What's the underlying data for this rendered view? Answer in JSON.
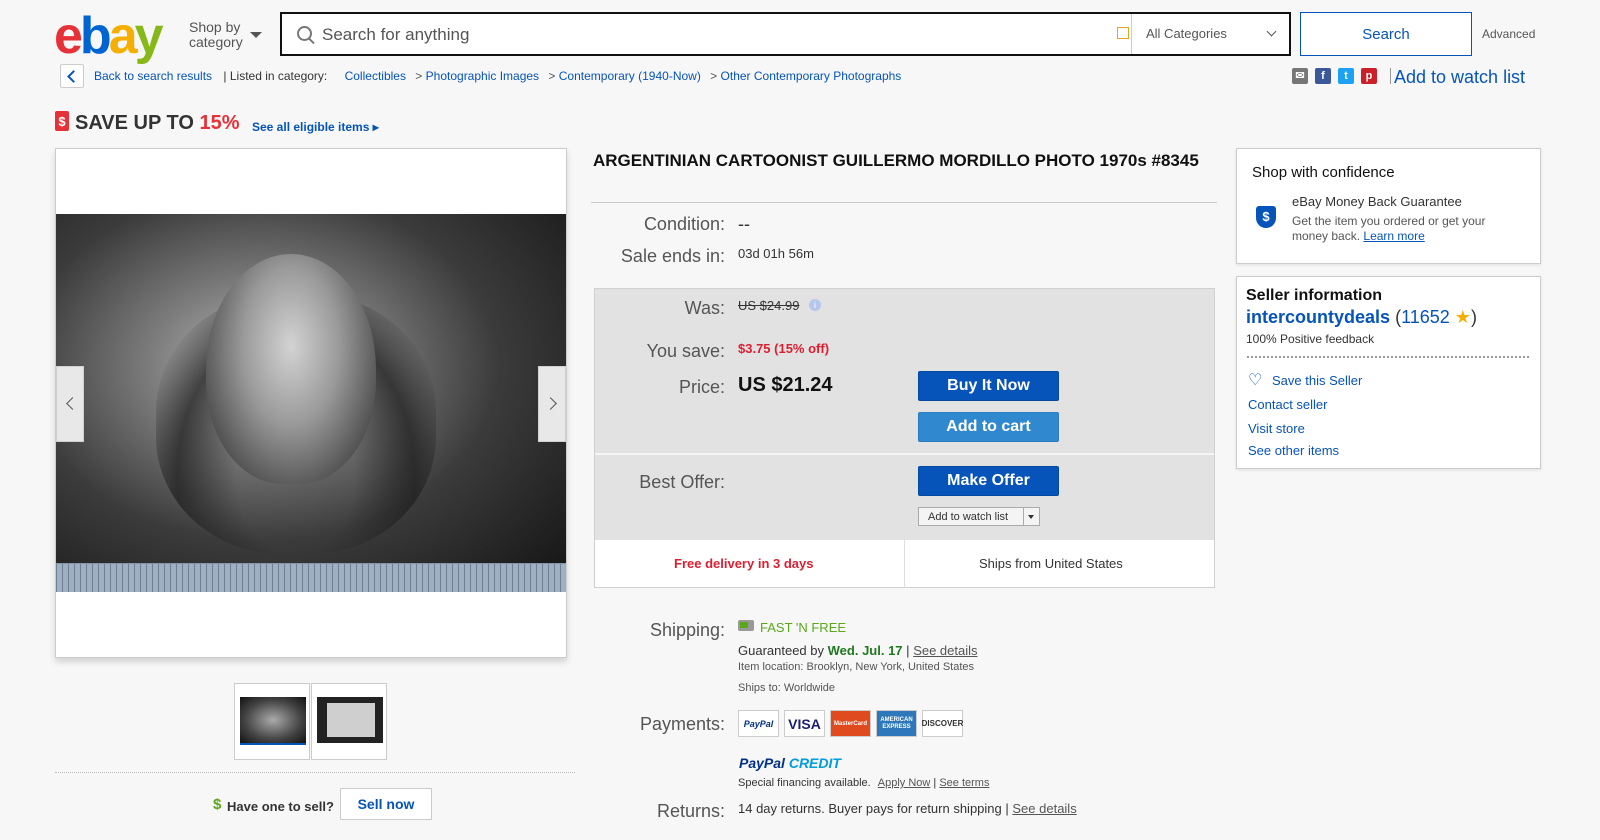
{
  "header": {
    "logo": {
      "e": "e",
      "b": "b",
      "a": "a",
      "y": "y"
    },
    "shop_by": "Shop by",
    "category": "category",
    "search_placeholder": "Search for anything",
    "category_select": "All Categories",
    "search_button": "Search",
    "advanced": "Advanced"
  },
  "breadcrumb": {
    "back": "Back to search results",
    "listed_in": "| Listed in category:",
    "items": [
      "Collectibles",
      "Photographic Images",
      "Contemporary (1940-Now)",
      "Other Contemporary Photographs"
    ],
    "separator": ">",
    "add_to_watch": "Add to watch list",
    "share_icons": [
      "email-icon",
      "facebook-icon",
      "twitter-icon",
      "pinterest-icon"
    ]
  },
  "promo": {
    "tag": "$",
    "save_prefix": "SAVE UP TO",
    "save_pct": "15%",
    "see_all": "See all eligible items ▸"
  },
  "gallery": {
    "prev": "previous-image",
    "next": "next-image",
    "thumbnails": 2
  },
  "sell": {
    "dollar": "$",
    "prompt": "Have one to sell?",
    "button": "Sell now"
  },
  "item": {
    "title": "ARGENTINIAN CARTOONIST GUILLERMO MORDILLO PHOTO 1970s #8345",
    "condition_label": "Condition:",
    "condition_value": "--",
    "sale_ends_label": "Sale ends in:",
    "sale_ends_value": "03d 01h 56m"
  },
  "pricing": {
    "was_label": "Was:",
    "was_value": "US $24.99",
    "info": "i",
    "you_save_label": "You save:",
    "you_save_value": "$3.75 (15% off)",
    "price_label": "Price:",
    "price_value": "US $21.24",
    "buy_now": "Buy It Now",
    "add_to_cart": "Add to cart",
    "best_offer_label": "Best Offer:",
    "make_offer": "Make Offer",
    "add_watch_small": "Add to watch list",
    "free_delivery": "Free delivery in 3 days",
    "ships_from": "Ships from United States"
  },
  "shipping": {
    "label": "Shipping:",
    "fast_free": "FAST 'N FREE",
    "guaranteed_prefix": "Guaranteed by",
    "guaranteed_date": "Wed. Jul. 17",
    "bar": "|",
    "see_details": "See details",
    "location_label": "Item location:",
    "location": "Brooklyn, New York, United States",
    "ships_to_label": "Ships to:",
    "ships_to": "Worldwide"
  },
  "payments": {
    "label": "Payments:",
    "cards": [
      "PayPal",
      "VISA",
      "MasterCard",
      "AMERICAN EXPRESS",
      "DISCOVER"
    ],
    "paypal_credit_a": "PayPal",
    "paypal_credit_b": "CREDIT",
    "financing": "Special financing available.",
    "apply_now": "Apply Now",
    "bar": "|",
    "see_terms": "See terms"
  },
  "returns": {
    "label": "Returns:",
    "text": "14 day returns. Buyer pays for return shipping |",
    "see_details": "See details"
  },
  "confidence": {
    "title": "Shop with confidence",
    "shield": "$",
    "mbg_title": "eBay Money Back Guarantee",
    "mbg_desc": "Get the item you ordered or get your money back.",
    "learn_more": "Learn more"
  },
  "seller": {
    "heading": "Seller information",
    "name": "intercountydeals",
    "open": "(",
    "score": "11652",
    "star": "★",
    "close": ")",
    "feedback": "100% Positive feedback",
    "save_seller": "Save this Seller",
    "contact": "Contact seller",
    "visit_store": "Visit store",
    "other_items": "See other items"
  },
  "colors": {
    "link": "#0654ba",
    "sale_red": "#dd1e31",
    "free_green": "#5ba71b"
  }
}
